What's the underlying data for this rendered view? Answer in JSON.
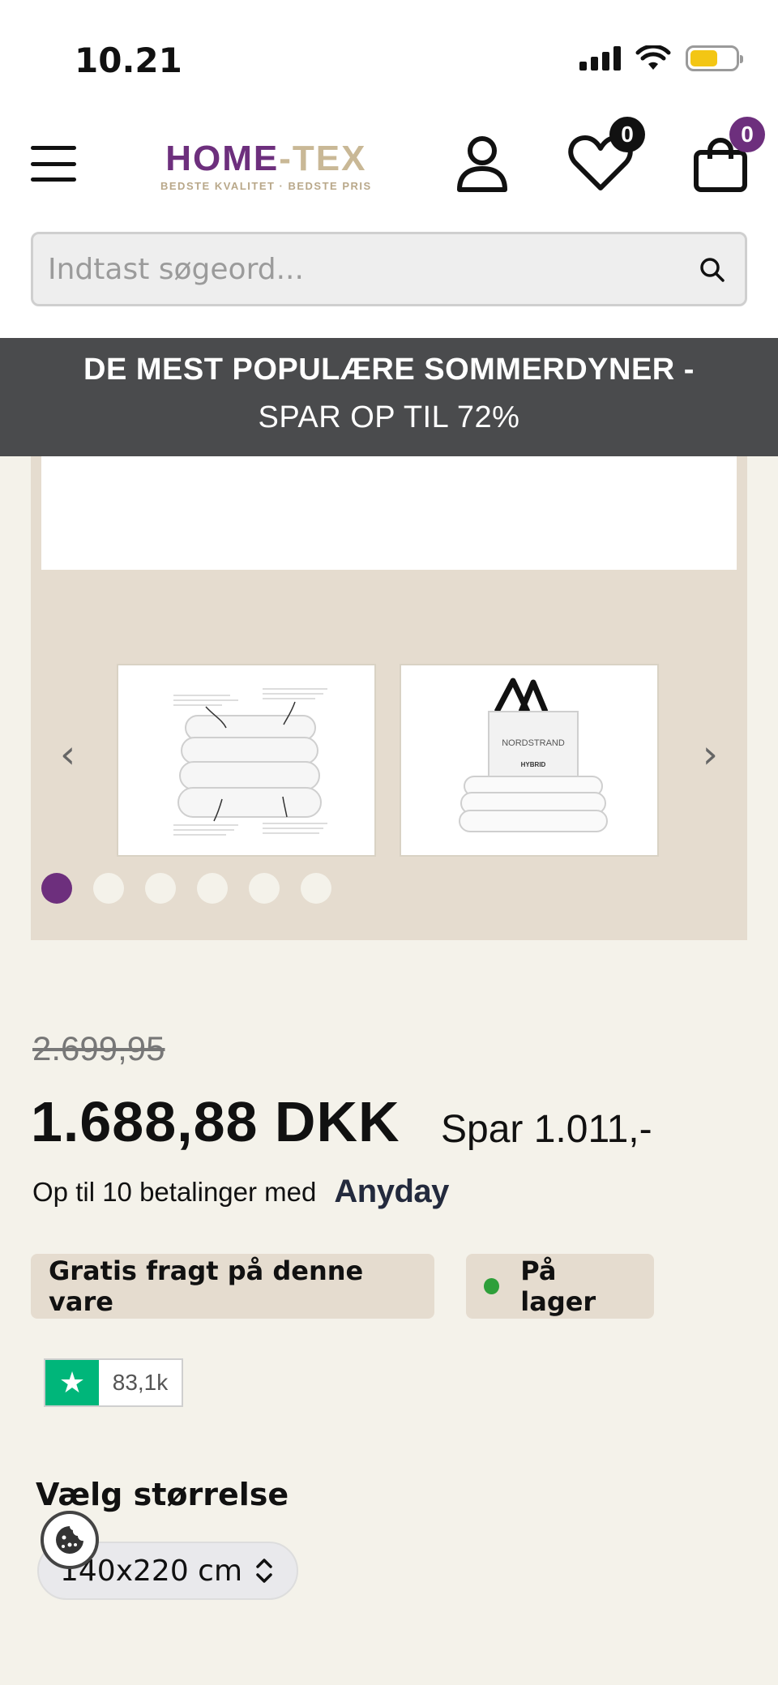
{
  "status_bar": {
    "time": "10.21",
    "battery_level": 0.6,
    "battery_color": "#f3c614"
  },
  "header": {
    "logo": {
      "main_left": "HOME",
      "main_dash": "-",
      "main_right": "TEX",
      "tagline": "BEDSTE KVALITET · BEDSTE PRIS",
      "brand_color": "#6d2f7d",
      "accent_color": "#c9b896"
    },
    "icons": [
      "menu-icon",
      "user-icon",
      "heart-icon",
      "cart-icon"
    ],
    "wishlist_count": "0",
    "cart_count": "0"
  },
  "search": {
    "placeholder": "Indtast søgeord..."
  },
  "promo": {
    "line1": "DE MEST POPULÆRE SOMMERDYNER -",
    "line2": "SPAR OP TIL 72%"
  },
  "gallery": {
    "prev_arrow": "‹",
    "next_arrow": "›",
    "thumb_bag_brand": "NORDSTRAND",
    "thumb_bag_product": "HYBRID",
    "dot_count": 6,
    "active_dot": 0
  },
  "price": {
    "old": "2.699,95",
    "new": "1.688,88 DKK",
    "save": "Spar 1.011,-",
    "installments": "Op til 10 betalinger med",
    "installments_provider": "Anyday"
  },
  "badges": {
    "shipping": "Gratis fragt på denne vare",
    "stock": "På lager",
    "stock_color": "#2e9f3a"
  },
  "trustpilot": {
    "count": "83,1k",
    "color": "#00b67a"
  },
  "size": {
    "label": "Vælg størrelse",
    "selected": "140x220 cm"
  }
}
